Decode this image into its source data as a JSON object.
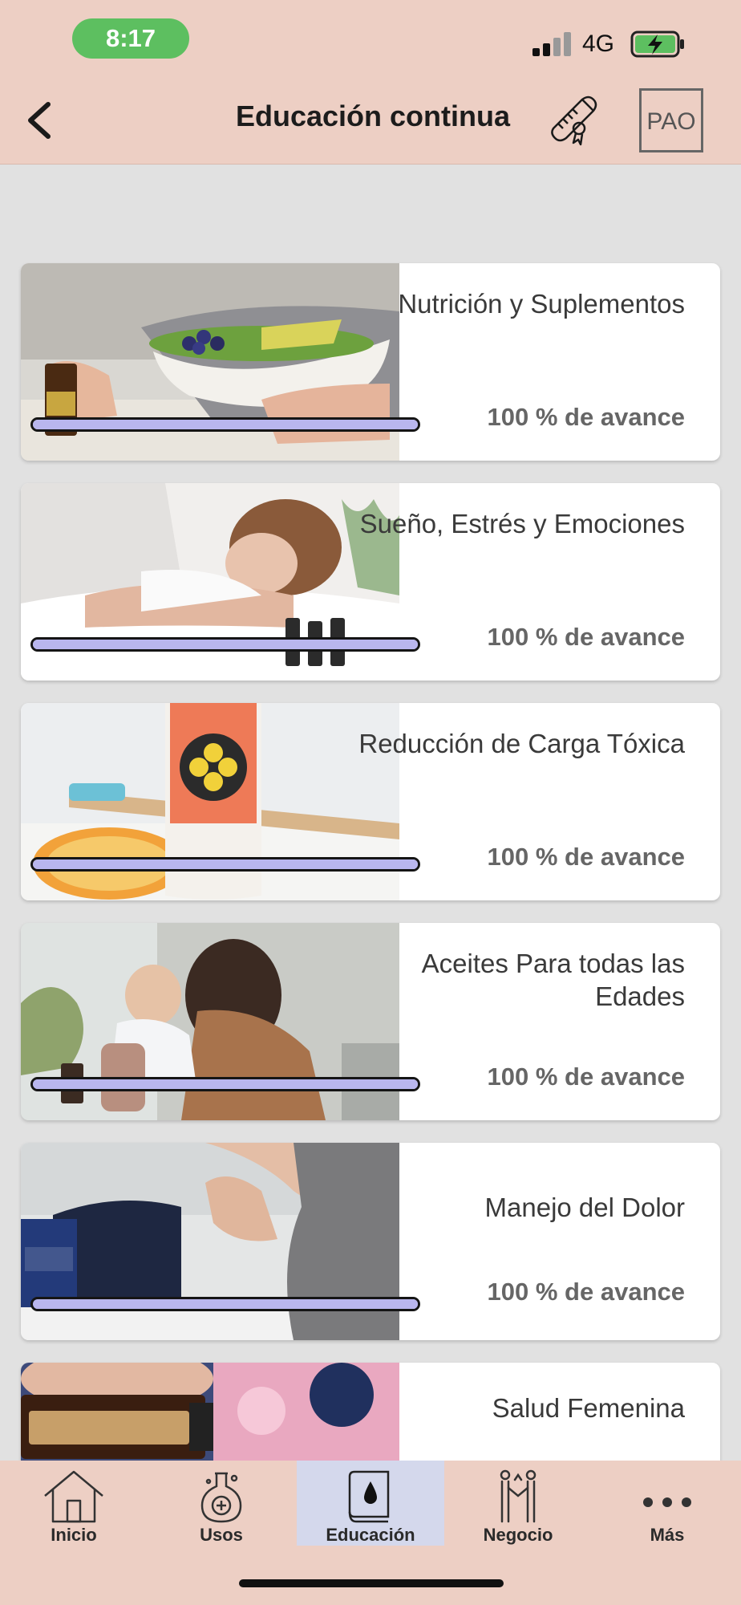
{
  "status_bar": {
    "time": "8:17",
    "network": "4G",
    "colors": {
      "time_pill": "#5dbf60",
      "battery_fill": "#5dbf60"
    }
  },
  "header": {
    "back_icon": "chevron-left-icon",
    "title": "Educación continua",
    "diploma_icon": "diploma-scroll-icon",
    "logo_text": "PAO",
    "background": "#edcfc4"
  },
  "courses": [
    {
      "title": "Nutrición y Suplementos",
      "progress_label": "100 % de avance",
      "progress_fraction": 1.0,
      "image": "food-bowl-with-oil-bottle"
    },
    {
      "title": "Sueño, Estrés y Emociones",
      "progress_label": "100 % de avance",
      "progress_fraction": 1.0,
      "image": "woman-sleeping"
    },
    {
      "title": "Reducción de Carga Tóxica",
      "progress_label": "100 % de avance",
      "progress_fraction": 1.0,
      "image": "toothpaste-and-oranges"
    },
    {
      "title": "Aceites Para todas las Edades",
      "progress_label": "100 % de avance",
      "progress_fraction": 1.0,
      "image": "mother-and-child"
    },
    {
      "title": "Manejo del Dolor",
      "progress_label": "100 % de avance",
      "progress_fraction": 1.0,
      "image": "deep-blue-box-and-elbow"
    },
    {
      "title": "Salud Femenina",
      "progress_label": "",
      "progress_fraction": 1.0,
      "image": "smart-and-sassy-bottle"
    }
  ],
  "progress_color": "#b9b6ee",
  "tabs": [
    {
      "id": "inicio",
      "label": "Inicio",
      "icon": "home-icon",
      "active": false
    },
    {
      "id": "usos",
      "label": "Usos",
      "icon": "potion-flask-icon",
      "active": false
    },
    {
      "id": "educacion",
      "label": "Educación",
      "icon": "book-drop-icon",
      "active": true
    },
    {
      "id": "negocio",
      "label": "Negocio",
      "icon": "handshake-people-icon",
      "active": false
    },
    {
      "id": "mas",
      "label": "Más",
      "icon": "more-dots-icon",
      "active": false
    }
  ]
}
